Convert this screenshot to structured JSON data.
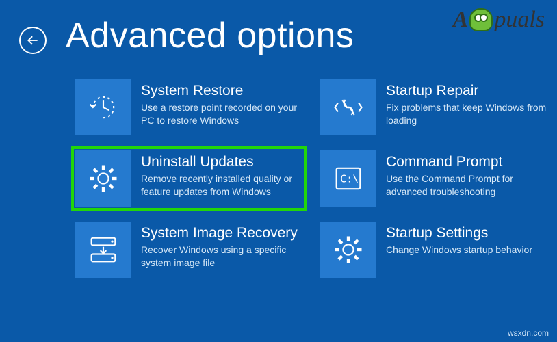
{
  "header": {
    "title": "Advanced options"
  },
  "tiles": {
    "system_restore": {
      "title": "System Restore",
      "desc": "Use a restore point recorded on your PC to restore Windows"
    },
    "startup_repair": {
      "title": "Startup Repair",
      "desc": "Fix problems that keep Windows from loading"
    },
    "uninstall_updates": {
      "title": "Uninstall Updates",
      "desc": "Remove recently installed quality or feature updates from Windows"
    },
    "command_prompt": {
      "title": "Command Prompt",
      "desc": "Use the Command Prompt for advanced troubleshooting"
    },
    "system_image_recovery": {
      "title": "System Image Recovery",
      "desc": "Recover Windows using a specific system image file"
    },
    "startup_settings": {
      "title": "Startup Settings",
      "desc": "Change Windows startup behavior"
    }
  },
  "watermark": {
    "prefix": "A",
    "suffix": "puals"
  },
  "source_note": "wsxdn.com"
}
